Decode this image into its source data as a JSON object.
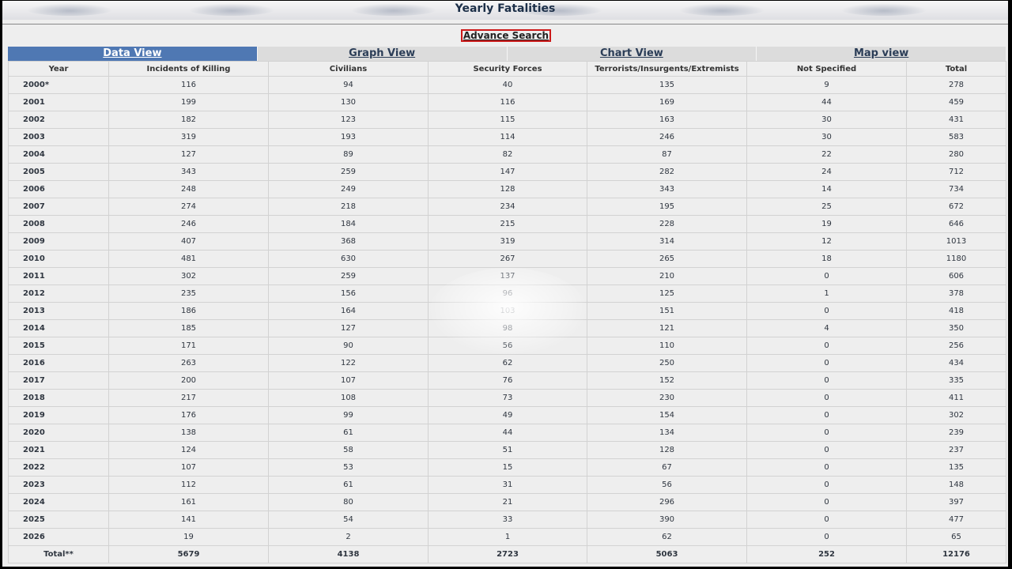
{
  "header": {
    "title": "Yearly Fatalities",
    "advance_search": "Advance Search"
  },
  "colors": {
    "active_tab": "#4f78b3",
    "inactive_tab": "#dcdcdc",
    "search_border": "#cc1a1a",
    "page_background": "#eeeeee"
  },
  "tabs": [
    {
      "label": "Data View",
      "active": true
    },
    {
      "label": "Graph View",
      "active": false
    },
    {
      "label": "Chart View",
      "active": false
    },
    {
      "label": "Map view",
      "active": false
    }
  ],
  "table": {
    "columns": [
      "Year",
      "Incidents of Killing",
      "Civilians",
      "Security Forces",
      "Terrorists/Insurgents/Extremists",
      "Not Specified",
      "Total"
    ],
    "rows": [
      [
        "2000*",
        "116",
        "94",
        "40",
        "135",
        "9",
        "278"
      ],
      [
        "2001",
        "199",
        "130",
        "116",
        "169",
        "44",
        "459"
      ],
      [
        "2002",
        "182",
        "123",
        "115",
        "163",
        "30",
        "431"
      ],
      [
        "2003",
        "319",
        "193",
        "114",
        "246",
        "30",
        "583"
      ],
      [
        "2004",
        "127",
        "89",
        "82",
        "87",
        "22",
        "280"
      ],
      [
        "2005",
        "343",
        "259",
        "147",
        "282",
        "24",
        "712"
      ],
      [
        "2006",
        "248",
        "249",
        "128",
        "343",
        "14",
        "734"
      ],
      [
        "2007",
        "274",
        "218",
        "234",
        "195",
        "25",
        "672"
      ],
      [
        "2008",
        "246",
        "184",
        "215",
        "228",
        "19",
        "646"
      ],
      [
        "2009",
        "407",
        "368",
        "319",
        "314",
        "12",
        "1013"
      ],
      [
        "2010",
        "481",
        "630",
        "267",
        "265",
        "18",
        "1180"
      ],
      [
        "2011",
        "302",
        "259",
        "137",
        "210",
        "0",
        "606"
      ],
      [
        "2012",
        "235",
        "156",
        "96",
        "125",
        "1",
        "378"
      ],
      [
        "2013",
        "186",
        "164",
        "103",
        "151",
        "0",
        "418"
      ],
      [
        "2014",
        "185",
        "127",
        "98",
        "121",
        "4",
        "350"
      ],
      [
        "2015",
        "171",
        "90",
        "56",
        "110",
        "0",
        "256"
      ],
      [
        "2016",
        "263",
        "122",
        "62",
        "250",
        "0",
        "434"
      ],
      [
        "2017",
        "200",
        "107",
        "76",
        "152",
        "0",
        "335"
      ],
      [
        "2018",
        "217",
        "108",
        "73",
        "230",
        "0",
        "411"
      ],
      [
        "2019",
        "176",
        "99",
        "49",
        "154",
        "0",
        "302"
      ],
      [
        "2020",
        "138",
        "61",
        "44",
        "134",
        "0",
        "239"
      ],
      [
        "2021",
        "124",
        "58",
        "51",
        "128",
        "0",
        "237"
      ],
      [
        "2022",
        "107",
        "53",
        "15",
        "67",
        "0",
        "135"
      ],
      [
        "2023",
        "112",
        "61",
        "31",
        "56",
        "0",
        "148"
      ],
      [
        "2024",
        "161",
        "80",
        "21",
        "296",
        "0",
        "397"
      ],
      [
        "2025",
        "141",
        "54",
        "33",
        "390",
        "0",
        "477"
      ],
      [
        "2026",
        "19",
        "2",
        "1",
        "62",
        "0",
        "65"
      ]
    ],
    "total_row": [
      "Total**",
      "5679",
      "4138",
      "2723",
      "5063",
      "252",
      "12176"
    ]
  }
}
